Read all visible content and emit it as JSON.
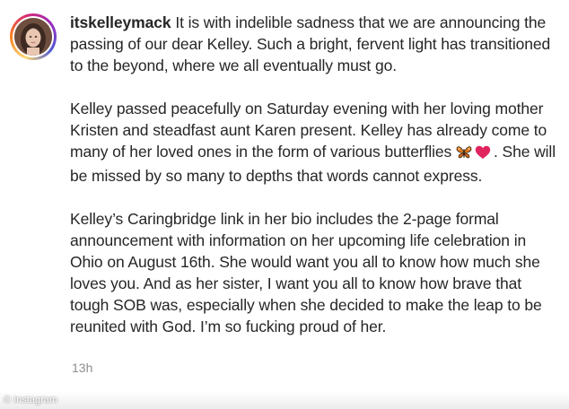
{
  "post": {
    "username": "itskelleymack",
    "paragraphs": [
      "It is with indelible sadness that we are announcing the passing of our dear Kelley. Such a bright, fervent light has transitioned to the beyond, where we all eventually must go.",
      "Kelley passed peacefully on Saturday evening with her loving mother Kristen and steadfast aunt Karen present. Kelley has already come to many of her loved ones in the form of various butterflies",
      ". She will be missed by so many to depths that words cannot express.",
      "Kelley’s Caringbridge link in her bio includes the 2-page formal announcement with information on her upcoming life celebration in Ohio on August 16th. She would want you all to know how much she loves you. And as her sister, I want you all to know how brave that tough SOB was, especially when she decided to make the leap to be reunited with God. I’m so fucking proud of her."
    ],
    "emojis": [
      "butterfly-icon",
      "red-heart-icon"
    ],
    "timestamp": "13h"
  },
  "credit": {
    "symbol": "©",
    "label": "Instagram"
  },
  "colors": {
    "text": "#262626",
    "muted": "#8e8e8e",
    "heart": "#e0245e"
  }
}
